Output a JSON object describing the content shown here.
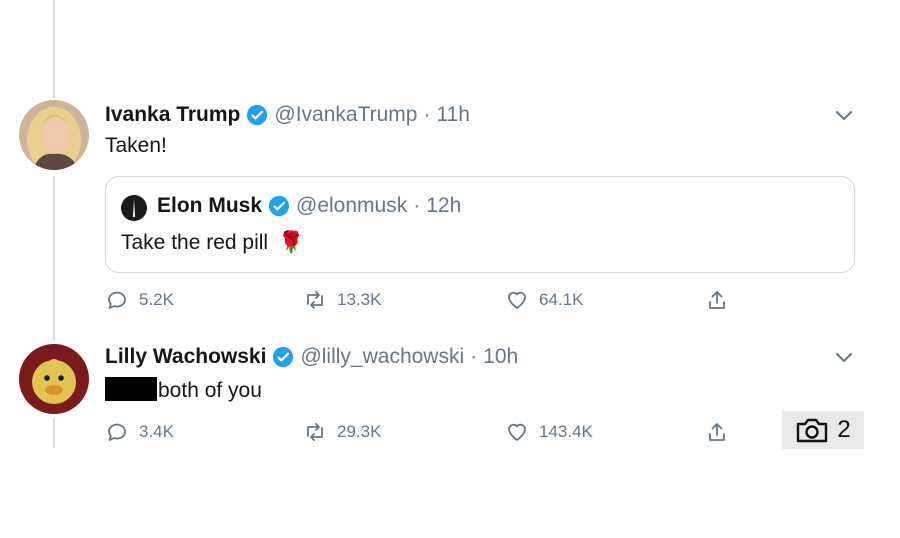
{
  "tweet1": {
    "name": "Ivanka Trump",
    "handle": "@IvankaTrump",
    "separator": "·",
    "time": "11h",
    "text": "Taken!",
    "replies": "5.2K",
    "retweets": "13.3K",
    "likes": "64.1K"
  },
  "quote": {
    "name": "Elon Musk",
    "handle": "@elonmusk",
    "separator": "·",
    "time": "12h",
    "text": "Take the red pill",
    "emoji": "🌹"
  },
  "tweet2": {
    "name": "Lilly Wachowski",
    "handle": "@lilly_wachowski",
    "separator": "·",
    "time": "10h",
    "text": "both of you",
    "replies": "3.4K",
    "retweets": "29.3K",
    "likes": "143.4K"
  },
  "camera": {
    "count": "2"
  },
  "colors": {
    "verified": "#1da1f2",
    "muted": "#657786",
    "border": "#ccd6dd"
  },
  "icons": [
    "verified-badge-icon",
    "chevron-down-icon",
    "reply-icon",
    "retweet-icon",
    "like-icon",
    "share-icon",
    "camera-icon"
  ]
}
